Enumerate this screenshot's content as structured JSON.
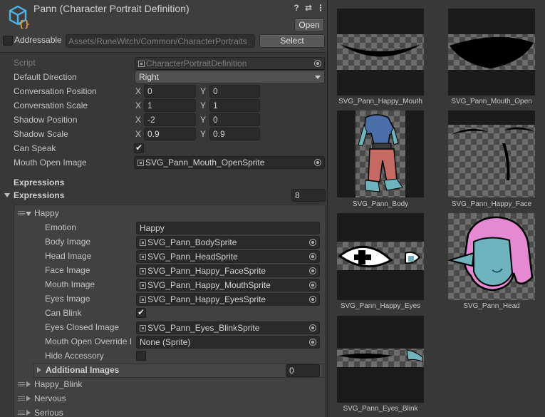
{
  "header": {
    "title": "Pann (Character Portrait Definition)",
    "open_label": "Open",
    "addressable_label": "Addressable",
    "addressable_checked": false,
    "asset_path": "Assets/RuneWitch/Common/CharacterPortraits",
    "select_label": "Select",
    "icons": [
      "help-icon",
      "preset-icon",
      "more-options-icon"
    ]
  },
  "script_row": {
    "label": "Script",
    "value": "CharacterPortraitDefinition"
  },
  "default_direction": {
    "label": "Default Direction",
    "value": "Right"
  },
  "conversation_position": {
    "label": "Conversation Position",
    "x": "0",
    "y": "0"
  },
  "conversation_scale": {
    "label": "Conversation Scale",
    "x": "1",
    "y": "1"
  },
  "shadow_position": {
    "label": "Shadow Position",
    "x": "-2",
    "y": "0"
  },
  "shadow_scale": {
    "label": "Shadow Scale",
    "x": "0.9",
    "y": "0.9"
  },
  "can_speak": {
    "label": "Can Speak",
    "checked": true
  },
  "mouth_open_image": {
    "label": "Mouth Open Image",
    "value": "SVG_Pann_Mouth_OpenSprite"
  },
  "axis_labels": {
    "x": "X",
    "y": "Y"
  },
  "expressions_header": "Expressions",
  "expressions_list": {
    "label": "Expressions",
    "count": "8"
  },
  "expression_happy": {
    "name": "Happy",
    "emotion_label": "Emotion",
    "emotion_value": "Happy",
    "body_label": "Body Image",
    "body_value": "SVG_Pann_BodySprite",
    "head_label": "Head Image",
    "head_value": "SVG_Pann_HeadSprite",
    "face_label": "Face Image",
    "face_value": "SVG_Pann_Happy_FaceSprite",
    "mouth_label": "Mouth Image",
    "mouth_value": "SVG_Pann_Happy_MouthSprite",
    "eyes_label": "Eyes Image",
    "eyes_value": "SVG_Pann_Happy_EyesSprite",
    "can_blink_label": "Can Blink",
    "can_blink_checked": true,
    "eyes_closed_label": "Eyes Closed Image",
    "eyes_closed_value": "SVG_Pann_Eyes_BlinkSprite",
    "mouth_override_label": "Mouth Open Override I",
    "mouth_override_value": "None (Sprite)",
    "hide_accessory_label": "Hide Accessory",
    "hide_accessory_checked": false,
    "additional_images_label": "Additional Images",
    "additional_images_count": "0"
  },
  "collapsed_expressions": [
    "Happy_Blink",
    "Nervous",
    "Serious"
  ],
  "preview": {
    "thumbnails": [
      "SVG_Pann_Happy_Mouth",
      "SVG_Pann_Mouth_Open",
      "SVG_Pann_Body",
      "SVG_Pann_Happy_Face",
      "SVG_Pann_Happy_Eyes",
      "SVG_Pann_Head",
      "SVG_Pann_Eyes_Blink"
    ]
  },
  "colors": {
    "inspector_bg": "#383838",
    "field_bg": "#2a2a2a",
    "asset_icon": "#4fb3e6",
    "asset_icon_accent": "#f0a030",
    "head_hair": "#e58ad2",
    "head_skin": "#6fb3bf",
    "body_shirt": "#4a6fa8",
    "body_pants": "#c46a62"
  }
}
